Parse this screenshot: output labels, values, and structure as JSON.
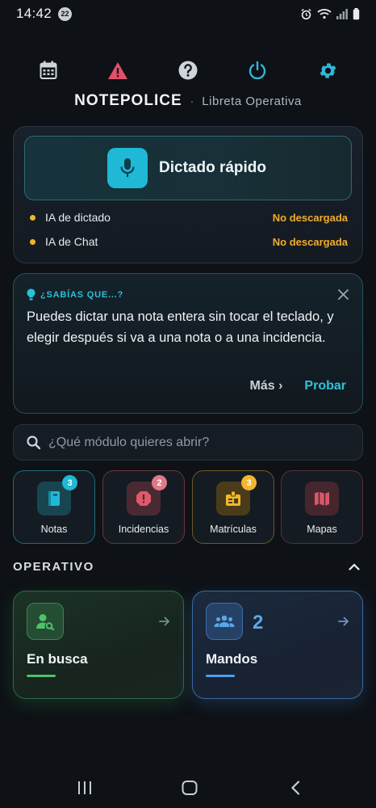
{
  "status": {
    "time": "14:42",
    "notification_count": "22"
  },
  "header": {
    "app_name": "NOTEPOLICE",
    "separator": "·",
    "subtitle": "Libreta Operativa"
  },
  "toolbar_icons": [
    "calendar-icon",
    "alert-icon",
    "help-icon",
    "power-icon",
    "settings-icon"
  ],
  "ai_card": {
    "dictado_label": "Dictado rápido",
    "rows": [
      {
        "label": "IA de dictado",
        "status": "No descargada"
      },
      {
        "label": "IA de Chat",
        "status": "No descargada"
      }
    ]
  },
  "tip": {
    "title": "¿SABÍAS QUE...?",
    "body": "Puedes dictar una nota entera sin tocar el teclado, y elegir después si va a una nota o a una incidencia.",
    "more": "Más ›",
    "try": "Probar"
  },
  "search": {
    "placeholder": "¿Qué módulo quieres abrir?"
  },
  "modules": [
    {
      "label": "Notas",
      "count": "3",
      "color": "#1fb8d6"
    },
    {
      "label": "Incidencias",
      "count": "2",
      "color": "#e0596a"
    },
    {
      "label": "Matrículas",
      "count": "3",
      "color": "#f2b62c"
    },
    {
      "label": "Mapas",
      "count": "",
      "color": "#d9566a"
    }
  ],
  "section": {
    "title": "OPERATIVO"
  },
  "operativo": [
    {
      "label": "En busca",
      "count": "",
      "color": "#4cc26b"
    },
    {
      "label": "Mandos",
      "count": "2",
      "color": "#4d9ef0"
    }
  ]
}
